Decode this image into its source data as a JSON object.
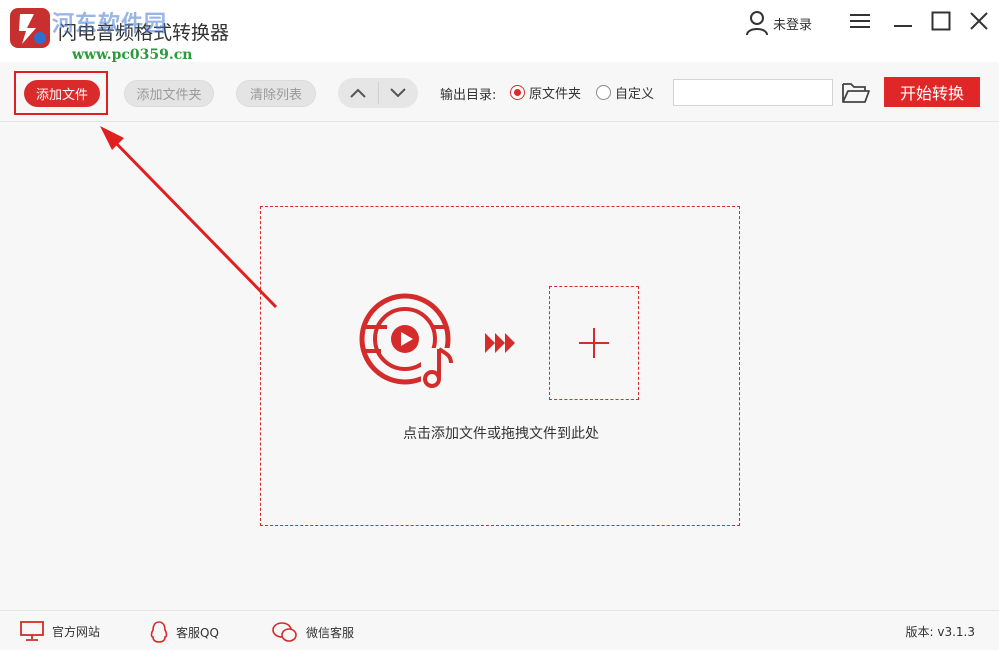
{
  "window": {
    "title": "闪电音频格式转换器",
    "watermark_cn": "河东软件园",
    "watermark_url": "www.pc0359.cn"
  },
  "user": {
    "label": "未登录",
    "icon": "user-icon"
  },
  "window_controls": [
    "menu-icon",
    "minimize-icon",
    "maximize-icon",
    "close-icon"
  ],
  "toolbar": {
    "add_file": "添加文件",
    "add_folder": "添加文件夹",
    "clear_list": "清除列表",
    "output_dir_label": "输出目录:",
    "radio_original": "原文件夹",
    "radio_custom": "自定义",
    "selected_output": "原文件夹",
    "path_value": "",
    "start": "开始转换"
  },
  "main": {
    "drop_hint": "点击添加文件或拖拽文件到此处"
  },
  "footer": {
    "website": "官方网站",
    "qq": "客服QQ",
    "wechat": "微信客服",
    "version": "版本: v3.1.3"
  },
  "colors": {
    "accent": "#d92b2b",
    "annotation": "#e02020"
  }
}
